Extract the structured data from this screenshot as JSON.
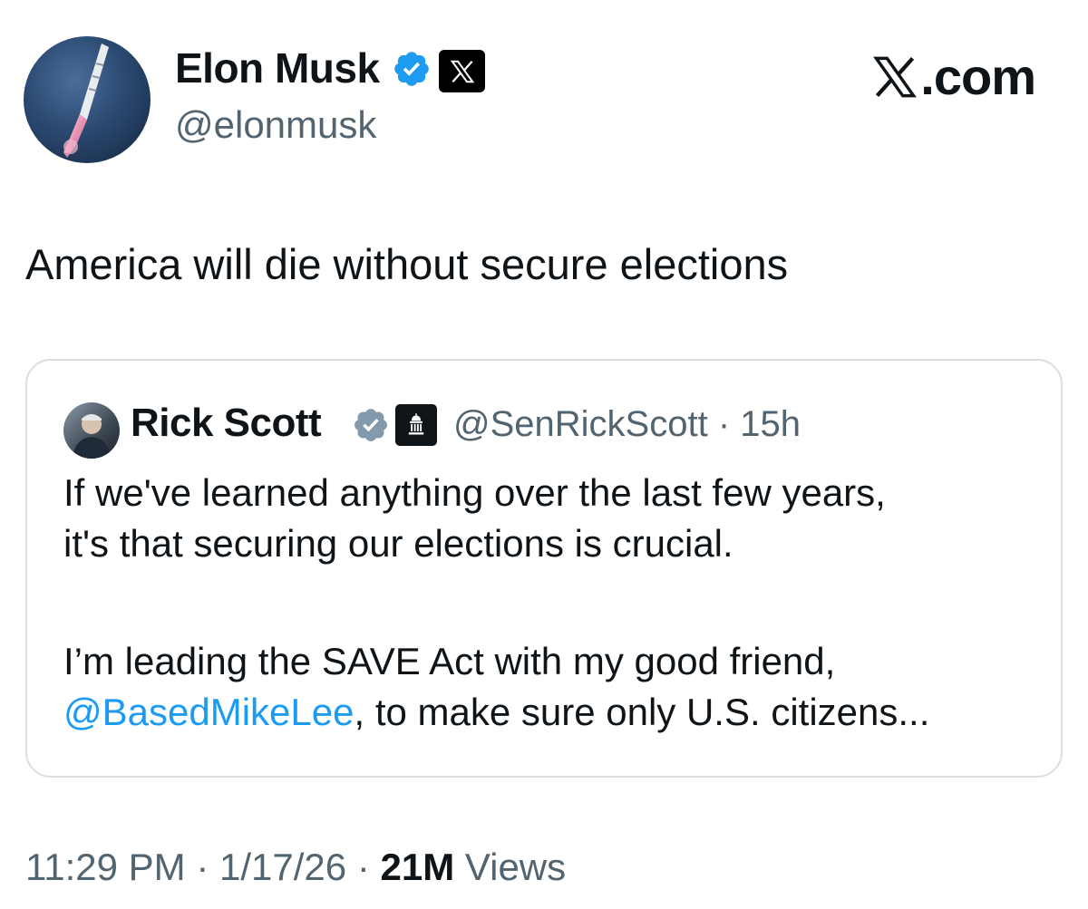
{
  "author": {
    "name": "Elon Musk",
    "handle": "@elonmusk",
    "avatar_icon": "rocket-launch-avatar",
    "verified_color": "#1d9bf0",
    "affiliation_icon": "x-logo-icon"
  },
  "brand": {
    "label": ".com",
    "icon": "x-logo-icon"
  },
  "tweet": {
    "text": "America will die without secure elections"
  },
  "quote": {
    "name": "Rick Scott",
    "handle": "@SenRickScott",
    "separator": "·",
    "time": "15h",
    "affiliation_icon": "government-building-icon",
    "verified_color": "#829aab",
    "line1": "If we've learned anything over the last few years,",
    "line2": "it's that securing our elections is crucial.",
    "line3": "I’m leading the SAVE Act with my good friend,",
    "mention": "@BasedMikeLee",
    "line4_rest": ", to make sure only U.S. citizens..."
  },
  "footer": {
    "time": "11:29 PM",
    "sep1": "·",
    "date": "1/17/26",
    "sep2": "·",
    "views_count": "21M",
    "views_label": "Views"
  },
  "colors": {
    "link": "#1d9bf0",
    "secondary_text": "#536471",
    "primary_text": "#0f1419",
    "card_border": "#d9dee2"
  }
}
